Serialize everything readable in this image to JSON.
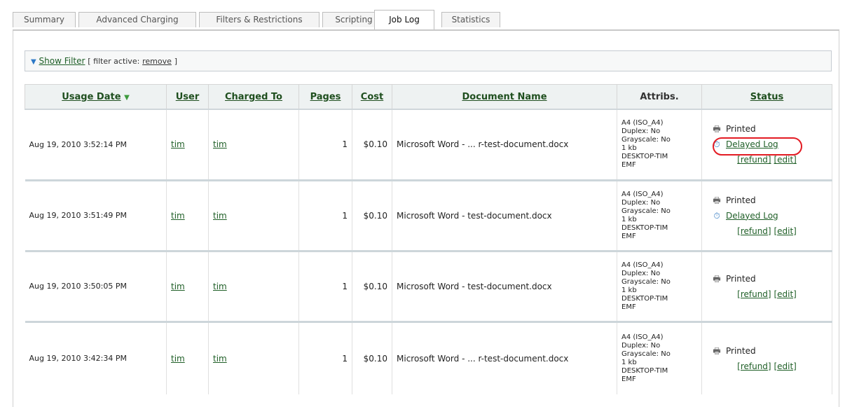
{
  "tabs": [
    {
      "label": "Summary"
    },
    {
      "label": "Advanced Charging"
    },
    {
      "label": "Filters & Restrictions"
    },
    {
      "label": "Scripting"
    },
    {
      "label": "Job Log"
    },
    {
      "label": "Statistics"
    }
  ],
  "active_tab": "Job Log",
  "filter": {
    "show_filter": "Show Filter",
    "active_prefix": "[ filter active:",
    "remove": "remove",
    "active_suffix": "]"
  },
  "table": {
    "headers": {
      "usage_date": "Usage Date",
      "user": "User",
      "charged_to": "Charged To",
      "pages": "Pages",
      "cost": "Cost",
      "document_name": "Document Name",
      "attribs": "Attribs.",
      "status": "Status"
    },
    "rows": [
      {
        "date": "Aug 19, 2010 3:52:14 PM",
        "user": "tim",
        "charged_to": "tim",
        "pages": "1",
        "cost": "$0.10",
        "document": "Microsoft Word - ... r-test-document.docx",
        "attribs": [
          "A4 (ISO_A4)",
          "Duplex: No",
          "Grayscale: No",
          "1 kb",
          "DESKTOP-TIM",
          "EMF"
        ],
        "status_printed": "Printed",
        "status_delayed": "Delayed Log",
        "refund": "[refund]",
        "edit": "[edit]"
      },
      {
        "date": "Aug 19, 2010 3:51:49 PM",
        "user": "tim",
        "charged_to": "tim",
        "pages": "1",
        "cost": "$0.10",
        "document": "Microsoft Word - test-document.docx",
        "attribs": [
          "A4 (ISO_A4)",
          "Duplex: No",
          "Grayscale: No",
          "1 kb",
          "DESKTOP-TIM",
          "EMF"
        ],
        "status_printed": "Printed",
        "status_delayed": "Delayed Log",
        "refund": "[refund]",
        "edit": "[edit]"
      },
      {
        "date": "Aug 19, 2010 3:50:05 PM",
        "user": "tim",
        "charged_to": "tim",
        "pages": "1",
        "cost": "$0.10",
        "document": "Microsoft Word - test-document.docx",
        "attribs": [
          "A4 (ISO_A4)",
          "Duplex: No",
          "Grayscale: No",
          "1 kb",
          "DESKTOP-TIM",
          "EMF"
        ],
        "status_printed": "Printed",
        "refund": "[refund]",
        "edit": "[edit]"
      },
      {
        "date": "Aug 19, 2010 3:42:34 PM",
        "user": "tim",
        "charged_to": "tim",
        "pages": "1",
        "cost": "$0.10",
        "document": "Microsoft Word - ... r-test-document.docx",
        "attribs": [
          "A4 (ISO_A4)",
          "Duplex: No",
          "Grayscale: No",
          "1 kb",
          "DESKTOP-TIM",
          "EMF"
        ],
        "status_printed": "Printed",
        "refund": "[refund]",
        "edit": "[edit]"
      }
    ]
  },
  "icons": {
    "sort": "sort-descending-arrow-icon",
    "filter_toggle": "disclosure-triangle-icon",
    "printed": "printer-icon",
    "delayed": "stopwatch-icon"
  },
  "colors": {
    "link": "#1f5f27",
    "highlight": "#e31b23",
    "sort_arrow": "#3d9a3d",
    "filter_arrow": "#2d79c7"
  }
}
